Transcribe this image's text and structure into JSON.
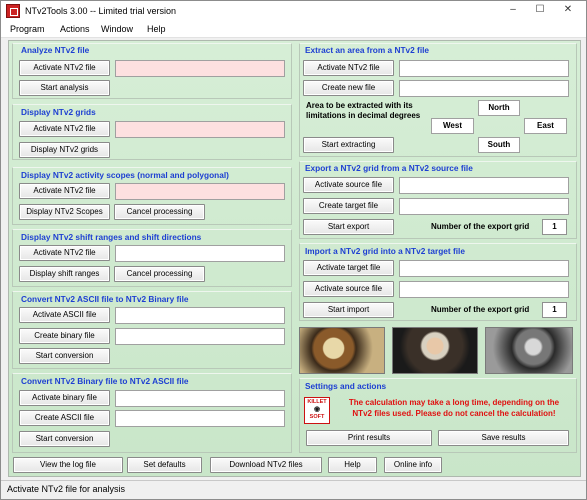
{
  "window": {
    "title": "NTv2Tools 3.00 -- Limited trial version",
    "min": "–",
    "max": "☐",
    "close": "✕"
  },
  "menu": [
    "Program",
    "Actions",
    "Window",
    "Help"
  ],
  "analyze": {
    "title": "Analyze NTv2 file",
    "activate": "Activate NTv2 file",
    "start": "Start analysis"
  },
  "display_grids": {
    "title": "Display NTv2 grids",
    "activate": "Activate NTv2 file",
    "action": "Display NTv2 grids"
  },
  "scopes": {
    "title": "Display NTv2 activity scopes (normal and polygonal)",
    "activate": "Activate NTv2 file",
    "action": "Display NTv2 Scopes",
    "cancel": "Cancel processing"
  },
  "shift": {
    "title": "Display NTv2 shift ranges and shift directions",
    "activate": "Activate NTv2 file",
    "action": "Display shift ranges",
    "cancel": "Cancel processing"
  },
  "ascii_to_bin": {
    "title": "Convert NTv2 ASCII file to NTv2 Binary file",
    "activate": "Activate ASCII file",
    "create": "Create binary file",
    "start": "Start conversion"
  },
  "bin_to_ascii": {
    "title": "Convert NTv2 Binary file to NTv2 ASCII file",
    "activate": "Activate binary file",
    "create": "Create ASCII file",
    "start": "Start conversion"
  },
  "extract": {
    "title": "Extract an area from a NTv2 file",
    "activate": "Activate NTv2 file",
    "create": "Create new file",
    "area_label": "Area to be extracted with its limitations in decimal degrees",
    "north": "North",
    "south": "South",
    "west": "West",
    "east": "East",
    "start": "Start extracting"
  },
  "export": {
    "title": "Export a NTv2 grid from a NTv2 source file",
    "activate": "Activate source file",
    "create": "Create target file",
    "start": "Start export",
    "number_label": "Number of the export grid",
    "number": "1"
  },
  "import": {
    "title": "Import a NTv2 grid into a NTv2 target file",
    "activate": "Activate target file",
    "source": "Activate source file",
    "start": "Start import",
    "number_label": "Number of the export grid",
    "number": "1"
  },
  "settings": {
    "title": "Settings and actions",
    "logo_top": "KILLET",
    "logo_bottom": "SOFT",
    "warning": "The calculation may take a long time, depending on the NTv2 files used. Please do not cancel the calculation!",
    "print": "Print results",
    "save": "Save results"
  },
  "bottom": {
    "log": "View the log file",
    "defaults": "Set defaults",
    "download": "Download NTv2 files",
    "help": "Help",
    "online": "Online info"
  },
  "status": "Activate NTv2 file for analysis"
}
